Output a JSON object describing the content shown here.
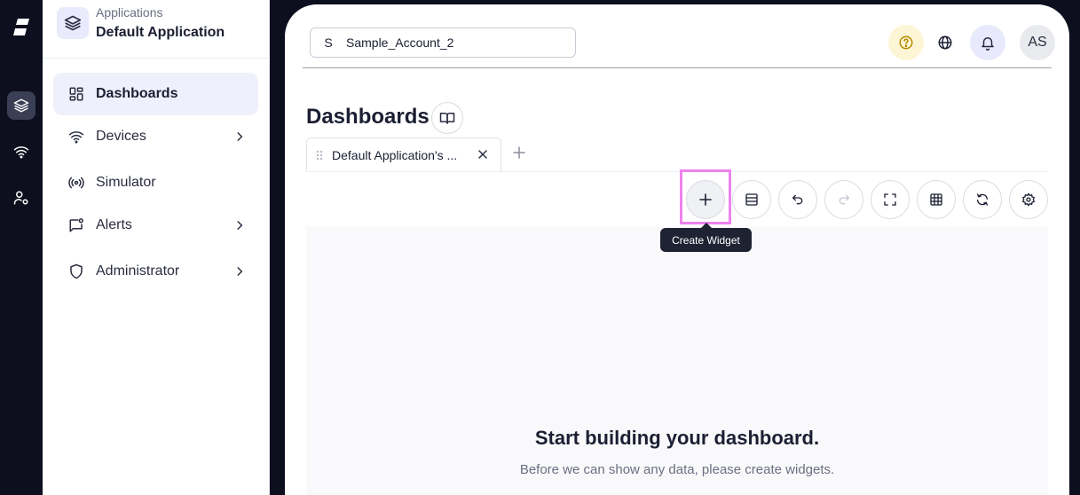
{
  "sidebar": {
    "app_label": "Applications",
    "app_name": "Default Application",
    "items": [
      {
        "label": "Dashboards",
        "icon": "dashboard-grid-icon",
        "active": true
      },
      {
        "label": "Devices",
        "icon": "wifi-icon",
        "has_submenu": true
      },
      {
        "label": "Simulator",
        "icon": "broadcast-icon"
      },
      {
        "label": "Alerts",
        "icon": "alert-message-icon",
        "has_submenu": true
      },
      {
        "label": "Administrator",
        "icon": "shield-icon",
        "has_submenu": true
      }
    ]
  },
  "header": {
    "account_initial": "S",
    "account_name": "Sample_Account_2",
    "avatar_initials": "AS"
  },
  "main": {
    "title": "Dashboards",
    "tabs": [
      {
        "label": "Default Application's ..."
      }
    ],
    "tooltip": "Create Widget",
    "empty_title": "Start building your dashboard.",
    "empty_subtitle": "Before we can show any data, please create widgets."
  },
  "colors": {
    "rail_bg": "#0d0f1e",
    "active_nav_bg": "#eef0fb",
    "highlight": "#ee82ee",
    "help_bg": "#fdf6d6",
    "bell_bg": "#e8e9fb"
  }
}
